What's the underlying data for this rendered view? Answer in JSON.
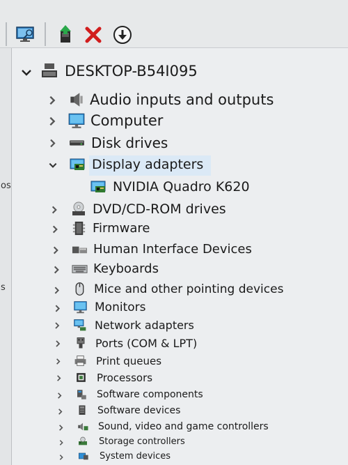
{
  "left_pane": {
    "fragment_1": "os",
    "fragment_2": "s"
  },
  "tree": {
    "root": {
      "label": "DESKTOP-B54I095",
      "icon": "computer-root-icon"
    },
    "items": [
      {
        "label": "Audio inputs and outputs",
        "icon": "speaker-icon"
      },
      {
        "label": "Computer",
        "icon": "monitor-icon"
      },
      {
        "label": "Disk drives",
        "icon": "disk-drive-icon"
      },
      {
        "label": "Display adapters",
        "icon": "display-adapter-icon",
        "expanded": true,
        "children": [
          {
            "label": "NVIDIA Quadro K620",
            "icon": "display-adapter-icon"
          }
        ]
      },
      {
        "label": "DVD/CD-ROM drives",
        "icon": "dvd-icon"
      },
      {
        "label": "Firmware",
        "icon": "firmware-icon"
      },
      {
        "label": "Human Interface Devices",
        "icon": "hid-icon"
      },
      {
        "label": "Keyboards",
        "icon": "keyboard-icon"
      },
      {
        "label": "Mice and other pointing devices",
        "icon": "mouse-icon"
      },
      {
        "label": "Monitors",
        "icon": "monitor-icon"
      },
      {
        "label": "Network adapters",
        "icon": "network-icon"
      },
      {
        "label": "Ports (COM & LPT)",
        "icon": "port-icon"
      },
      {
        "label": "Print queues",
        "icon": "printer-icon"
      },
      {
        "label": "Processors",
        "icon": "processor-icon"
      },
      {
        "label": "Software components",
        "icon": "software-component-icon"
      },
      {
        "label": "Software devices",
        "icon": "software-device-icon"
      },
      {
        "label": "Sound, video and game controllers",
        "icon": "sound-icon"
      },
      {
        "label": "Storage controllers",
        "icon": "storage-icon"
      },
      {
        "label": "System devices",
        "icon": "system-icon"
      }
    ]
  }
}
